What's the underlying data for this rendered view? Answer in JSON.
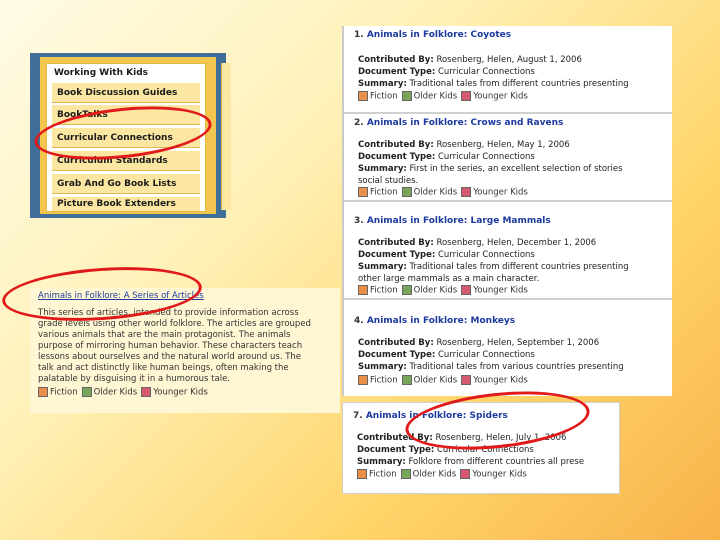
{
  "menu": {
    "title": "Working With Kids",
    "items": [
      "Book Discussion Guides",
      "BookTalks",
      "Curricular Connections",
      "Curriculum Standards",
      "Grab And Go Book Lists",
      "Picture Book Extenders"
    ]
  },
  "article": {
    "title": "Animals in Folklore: A Series of Articles",
    "body_lines": [
      "This series of articles, intended to provide information across",
      "grade levels using other world folklore. The articles are grouped",
      "various animals that are the main protagonist. The animals",
      "purpose of mirroring human behavior. These characters teach",
      "lessons about ourselves and the natural world around us. The",
      "talk and act distinctly like human beings, often making the",
      "palatable by disguising it in a humorous tale."
    ],
    "tags": [
      "Fiction",
      "Older Kids",
      "Younger Kids"
    ]
  },
  "labels": {
    "contributed_by": "Contributed By:",
    "document_type": "Document Type:",
    "summary": "Summary:"
  },
  "records": [
    {
      "num": "1.",
      "title": "Animals in Folklore: Coyotes",
      "contributed": "Rosenberg, Helen, August 1, 2006",
      "doctype": "Curricular Connections",
      "summary": "Traditional tales from different countries presenting",
      "summary2": "",
      "tags": [
        "Fiction",
        "Older Kids",
        "Younger Kids"
      ]
    },
    {
      "num": "2.",
      "title": "Animals in Folklore: Crows and Ravens",
      "contributed": "Rosenberg, Helen, May 1, 2006",
      "doctype": "Curricular Connections",
      "summary": "First in the series, an excellent selection of stories",
      "summary2": "social studies.",
      "tags": [
        "Fiction",
        "Older Kids",
        "Younger Kids"
      ]
    },
    {
      "num": "3.",
      "title": "Animals in Folklore: Large Mammals",
      "contributed": "Rosenberg, Helen, December 1, 2006",
      "doctype": "Curricular Connections",
      "summary": "Traditional tales from different countries presenting",
      "summary2": "other large mammals as a main character.",
      "tags": [
        "Fiction",
        "Older Kids",
        "Younger Kids"
      ]
    },
    {
      "num": "4.",
      "title": "Animals in Folklore: Monkeys",
      "contributed": "Rosenberg, Helen, September 1, 2006",
      "doctype": "Curricular Connections",
      "summary": "Traditional tales from various countries presenting",
      "summary2": "",
      "tags": [
        "Fiction",
        "Older Kids",
        "Younger Kids"
      ]
    }
  ],
  "record7": {
    "num": "7.",
    "title": "Animals in Folklore: Spiders",
    "contributed": "Rosenberg, Helen, July 1, 2006",
    "doctype": "Curricular Connections",
    "summary": "Folklore from different countries all prese",
    "tags": [
      "Fiction",
      "Older Kids",
      "Younger Kids"
    ]
  },
  "colors": {
    "link": "#1d3aa0",
    "annotation": "#e01a1a",
    "fiction": "#e98f47",
    "older_kids": "#79a55b",
    "younger_kids": "#d55a70"
  }
}
